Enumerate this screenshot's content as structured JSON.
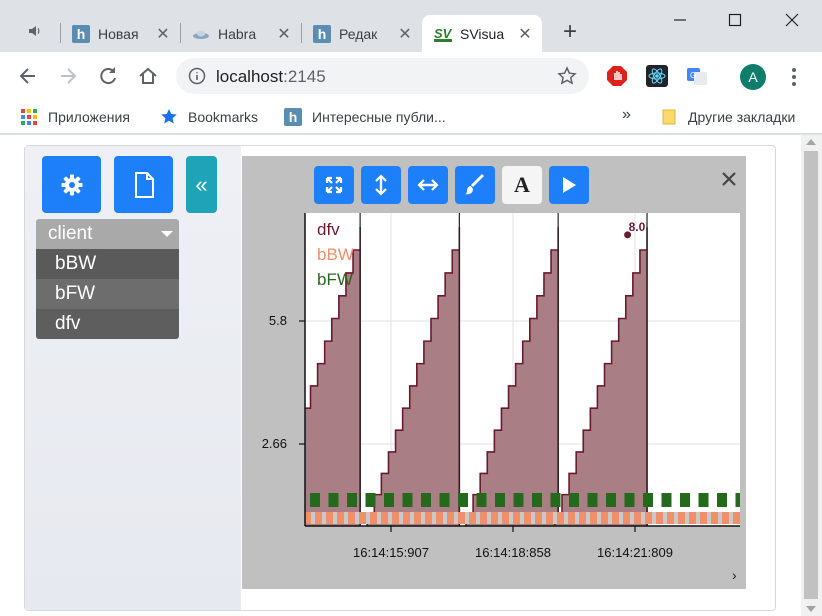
{
  "browser": {
    "tabs": [
      {
        "title": "Новая",
        "favicon": "habr-h-icon"
      },
      {
        "title": "Habra",
        "favicon": "habr-saucer-icon"
      },
      {
        "title": "Редак",
        "favicon": "habr-h-icon"
      },
      {
        "title": "SVisua",
        "favicon": "sv-icon",
        "active": true
      }
    ],
    "sv_favicon_text": "SV",
    "habr_favicon_text": "h",
    "address": {
      "host": "localhost",
      "port": ":2145"
    },
    "profile_initial": "A",
    "bookmarks": {
      "apps": "Приложения",
      "bookmarks": "Bookmarks",
      "habr": "Интересные публи...",
      "overflow": "»",
      "other": "Другие закладки"
    }
  },
  "app": {
    "sidebar_toggle": "«",
    "dropdown": {
      "selected": "client",
      "options": [
        "bBW",
        "bFW",
        "dfv"
      ]
    },
    "chart_buttons": [
      "expand-icon",
      "vertical-resize-icon",
      "horizontal-resize-icon",
      "brush-icon",
      "font-icon",
      "play-icon"
    ],
    "font_button_label": "A"
  },
  "chart_data": {
    "type": "area",
    "series": [
      {
        "name": "dfv",
        "color": "#6b1a2e",
        "fill": "#a97e84"
      },
      {
        "name": "bBW",
        "color": "#f0906a"
      },
      {
        "name": "bFW",
        "color": "#256a1c"
      }
    ],
    "x_tick_labels": [
      "16:14:15:907",
      "16:14:18:858",
      "16:14:21:809"
    ],
    "y_tick_labels": [
      "5.8",
      "2.66"
    ],
    "y_ticks": [
      5.8,
      2.66
    ],
    "dfv": {
      "cycle_period_s": 2.4,
      "ramp_peak": 8.2,
      "cycle_ends": [
        "16:14:15:160",
        "16:14:17:560",
        "16:14:19:950",
        "16:14:22:100"
      ],
      "highlight_point": {
        "time": "16:14:21:630",
        "value": 8.0,
        "label": "8.0"
      }
    },
    "grid": true,
    "legend_position": "top-left"
  }
}
